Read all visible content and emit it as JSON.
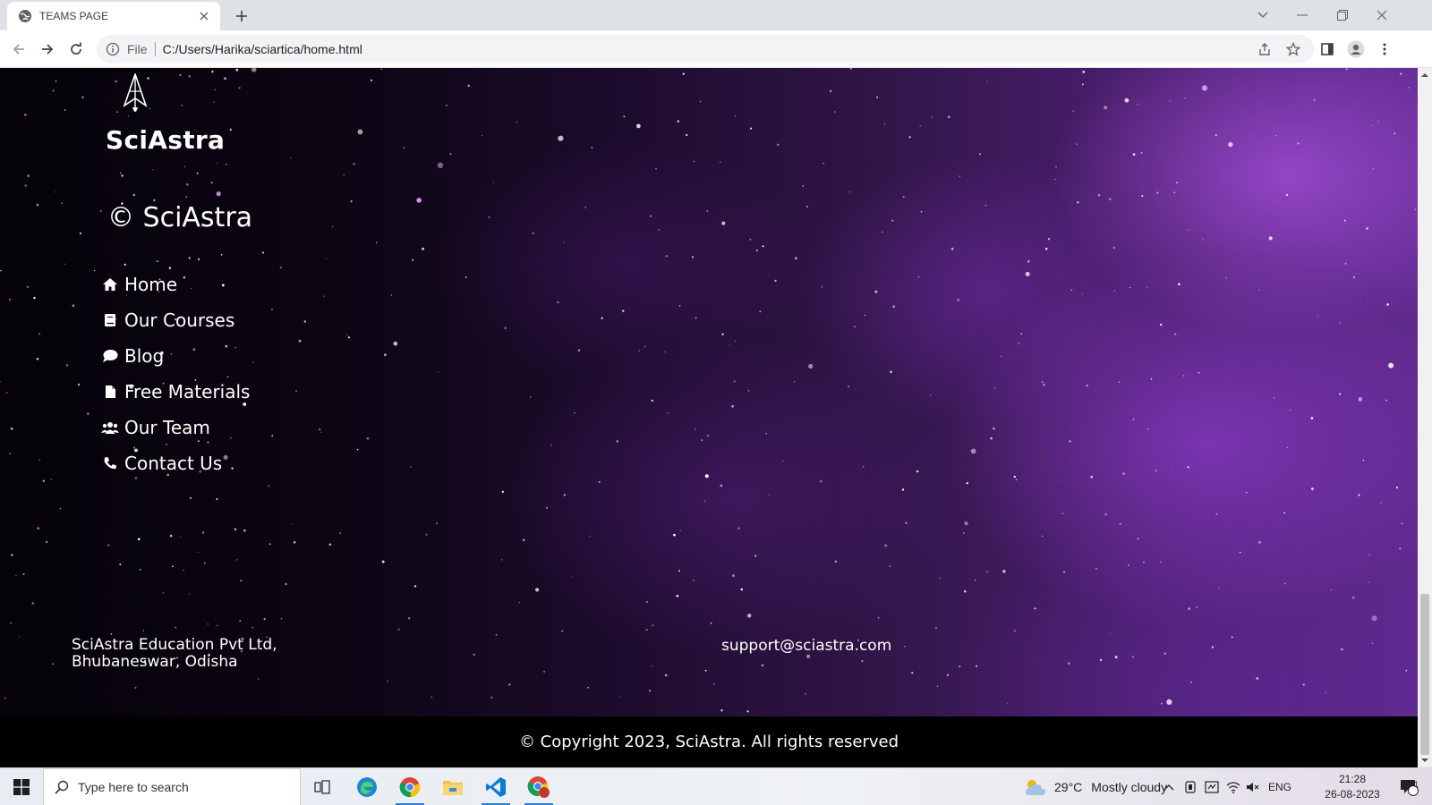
{
  "browser": {
    "tab_title": "TEAMS PAGE",
    "scheme_label": "File",
    "url": "C:/Users/Harika/sciartica/home.html"
  },
  "page": {
    "brand": "SciAstra",
    "copyright_line": "© SciAstra",
    "menu": [
      {
        "label": "Home",
        "icon": "home-icon"
      },
      {
        "label": "Our Courses",
        "icon": "book-icon"
      },
      {
        "label": "Blog",
        "icon": "comment-icon"
      },
      {
        "label": "Free Materials",
        "icon": "file-icon"
      },
      {
        "label": "Our Team",
        "icon": "users-icon"
      },
      {
        "label": "Contact Us",
        "icon": "phone-icon"
      }
    ],
    "address_line1": "SciAstra Education Pvt Ltd,",
    "address_line2": "Bhubaneswar, Odisha",
    "email": "support@sciastra.com",
    "footer": "© Copyright 2023, SciAstra. All rights reserved"
  },
  "taskbar": {
    "search_placeholder": "Type here to search",
    "temperature": "29°C",
    "weather": "Mostly cloudy",
    "language": "ENG",
    "time": "21:28",
    "date": "26-08-2023",
    "notification_count": "1"
  },
  "colors": {
    "space_dark": "#050208",
    "space_purple": "#5f2a8e",
    "footer_bg": "#000000",
    "text": "#ffffff",
    "accent_blue": "#2b7bd6"
  }
}
